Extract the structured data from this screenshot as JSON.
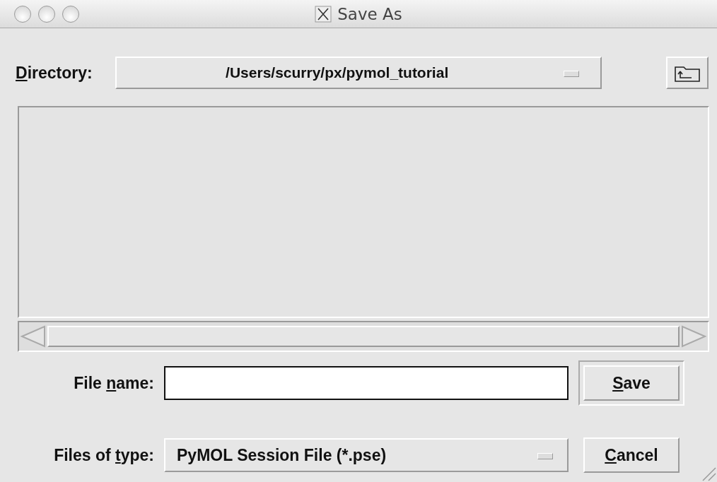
{
  "window": {
    "title": "Save As"
  },
  "directory": {
    "label": {
      "mnemonic": "D",
      "rest": "irectory:"
    },
    "value": "/Users/scurry/px/pymol_tutorial"
  },
  "file_list": {
    "kind": "empty"
  },
  "file_name": {
    "label": {
      "before": "File ",
      "mnemonic": "n",
      "rest": "ame:"
    }
  },
  "file_type": {
    "label": {
      "before": "Files of ",
      "mnemonic": "t",
      "rest": "ype:"
    },
    "value": "PyMOL Session File (*.pse)"
  },
  "buttons": [
    {
      "kind": "default",
      "label": {
        "mnemonic": "S",
        "rest": "ave"
      }
    },
    {
      "kind": "normal",
      "label": {
        "mnemonic": "C",
        "rest": "ancel"
      }
    }
  ]
}
